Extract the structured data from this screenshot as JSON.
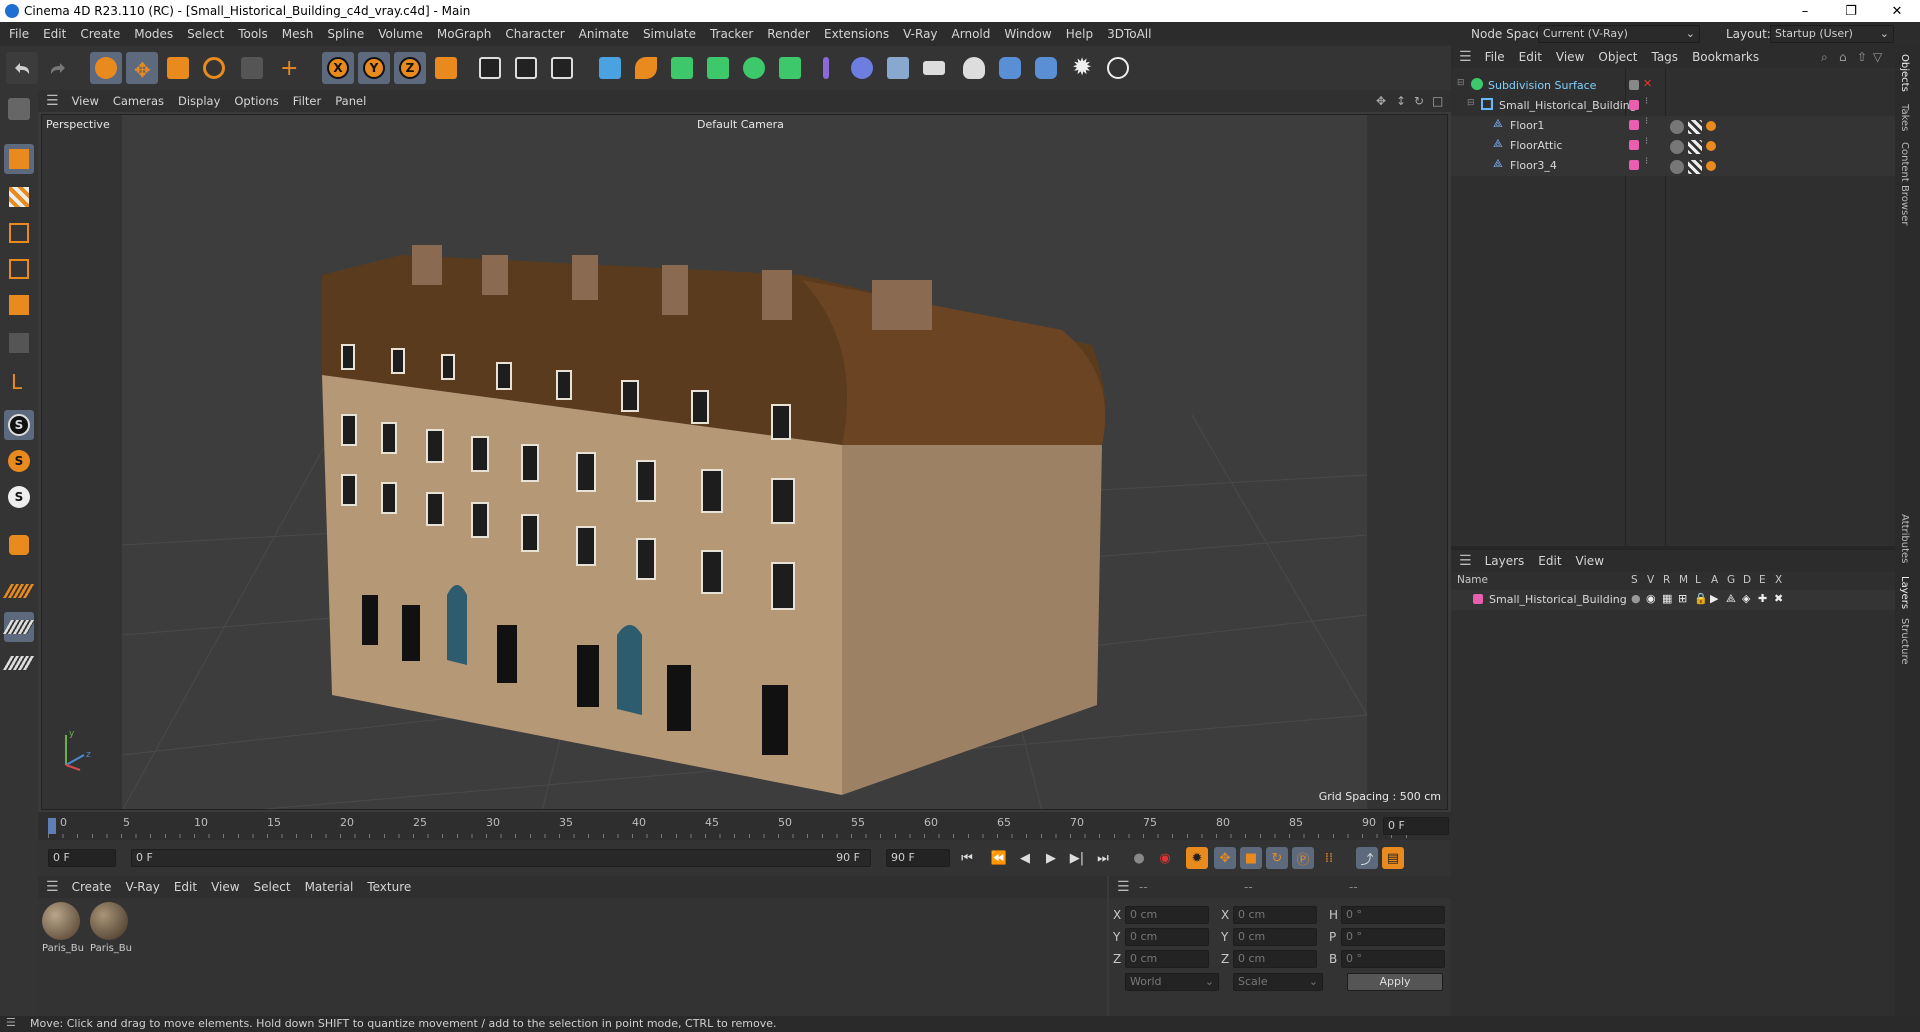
{
  "title": "Cinema 4D R23.110 (RC) - [Small_Historical_Building_c4d_vray.c4d] - Main",
  "window_controls": [
    "–",
    "❐",
    "✕"
  ],
  "menu": [
    "File",
    "Edit",
    "Create",
    "Modes",
    "Select",
    "Tools",
    "Mesh",
    "Spline",
    "Volume",
    "MoGraph",
    "Character",
    "Animate",
    "Simulate",
    "Tracker",
    "Render",
    "Extensions",
    "V-Ray",
    "Arnold",
    "Window",
    "Help",
    "3DToAll"
  ],
  "node_space": {
    "label": "Node Space:",
    "value": "Current (V-Ray)"
  },
  "layout": {
    "label": "Layout:",
    "value": "Startup (User)"
  },
  "viewport": {
    "menu": [
      "View",
      "Cameras",
      "Display",
      "Options",
      "Filter",
      "Panel"
    ],
    "label": "Perspective",
    "camera": "Default Camera",
    "grid_spacing": "Grid Spacing : 500 cm"
  },
  "timeline": {
    "ticks": [
      "0",
      "5",
      "10",
      "15",
      "20",
      "25",
      "30",
      "35",
      "40",
      "45",
      "50",
      "55",
      "60",
      "65",
      "70",
      "75",
      "80",
      "85",
      "90"
    ],
    "current_frame": "0 F",
    "frame_out": "0 F"
  },
  "transport": {
    "start": "0 F",
    "range_start": "0 F",
    "range_end": "90 F",
    "end": "90 F"
  },
  "materials": {
    "menu": [
      "Create",
      "V-Ray",
      "Edit",
      "View",
      "Select",
      "Material",
      "Texture"
    ],
    "items": [
      "Paris_Bu",
      "Paris_Bu"
    ]
  },
  "coords": {
    "headers": [
      "--",
      "--",
      "--"
    ],
    "rows": [
      {
        "a": "X",
        "av": "0 cm",
        "b": "X",
        "bv": "0 cm",
        "c": "H",
        "cv": "0 °"
      },
      {
        "a": "Y",
        "av": "0 cm",
        "b": "Y",
        "bv": "0 cm",
        "c": "P",
        "cv": "0 °"
      },
      {
        "a": "Z",
        "av": "0 cm",
        "b": "Z",
        "bv": "0 cm",
        "c": "B",
        "cv": "0 °"
      }
    ],
    "world": "World",
    "scale": "Scale",
    "apply": "Apply"
  },
  "objects": {
    "menu": [
      "File",
      "Edit",
      "View",
      "Object",
      "Tags",
      "Bookmarks"
    ],
    "items": [
      "Subdivision Surface",
      "Small_Historical_Building",
      "Floor1",
      "FloorAttic",
      "Floor3_4"
    ]
  },
  "layers": {
    "menu": [
      "Layers",
      "Edit",
      "View"
    ],
    "name_header": "Name",
    "columns": [
      "S",
      "V",
      "R",
      "M",
      "L",
      "A",
      "G",
      "D",
      "E",
      "X"
    ],
    "items": [
      "Small_Historical_Building"
    ]
  },
  "side_tabs": [
    "Objects",
    "Takes",
    "Content Browser",
    "Attributes",
    "Layers",
    "Structure"
  ],
  "status": "Move: Click and drag to move elements. Hold down SHIFT to quantize movement / add to the selection in point mode, CTRL to remove.",
  "colors": {
    "accent": "#e98a1f",
    "layer_pink": "#e85fb0",
    "selected": "#5d6a7d"
  }
}
